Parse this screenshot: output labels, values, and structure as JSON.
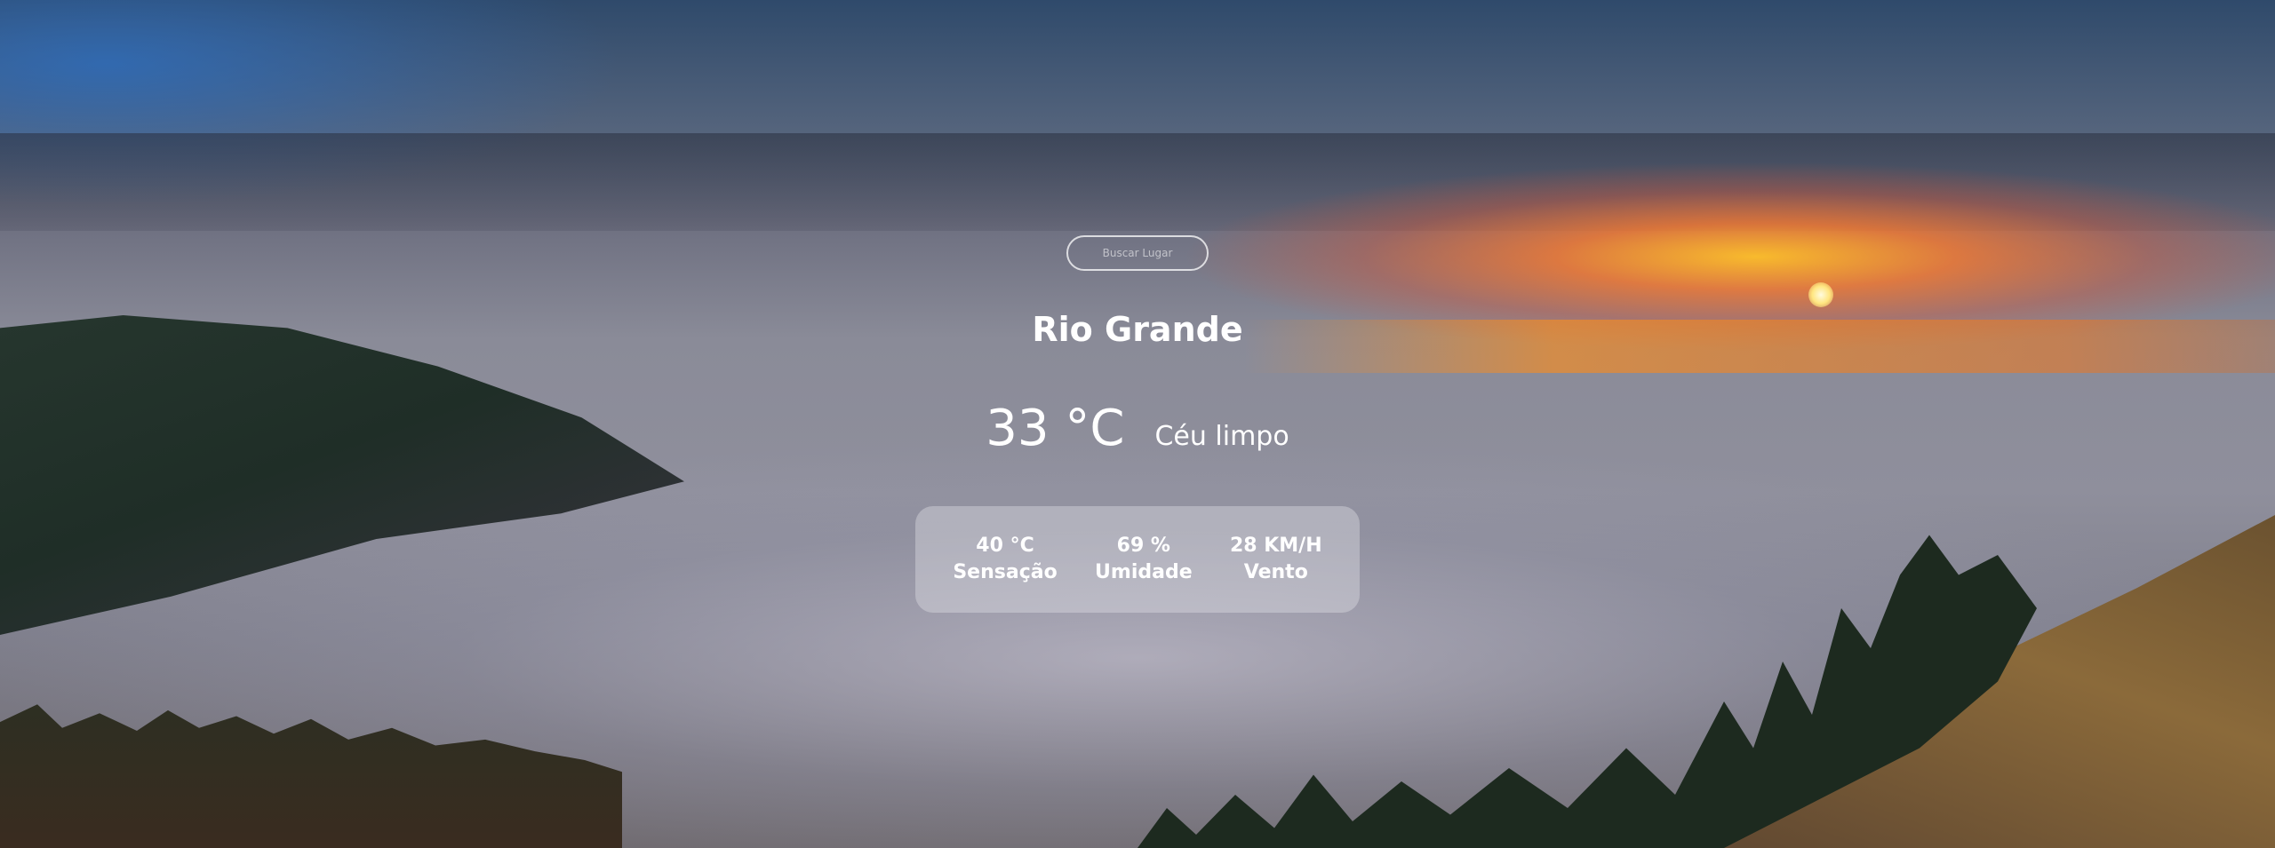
{
  "search": {
    "placeholder": "Buscar Lugar",
    "value": ""
  },
  "weather": {
    "city": "Rio Grande",
    "temperature": "33 °C",
    "description": "Céu limpo",
    "details": [
      {
        "value": "40 °C",
        "label": "Sensação"
      },
      {
        "value": "69 %",
        "label": "Umidade"
      },
      {
        "value": "28 KM/H",
        "label": "Vento"
      }
    ]
  }
}
